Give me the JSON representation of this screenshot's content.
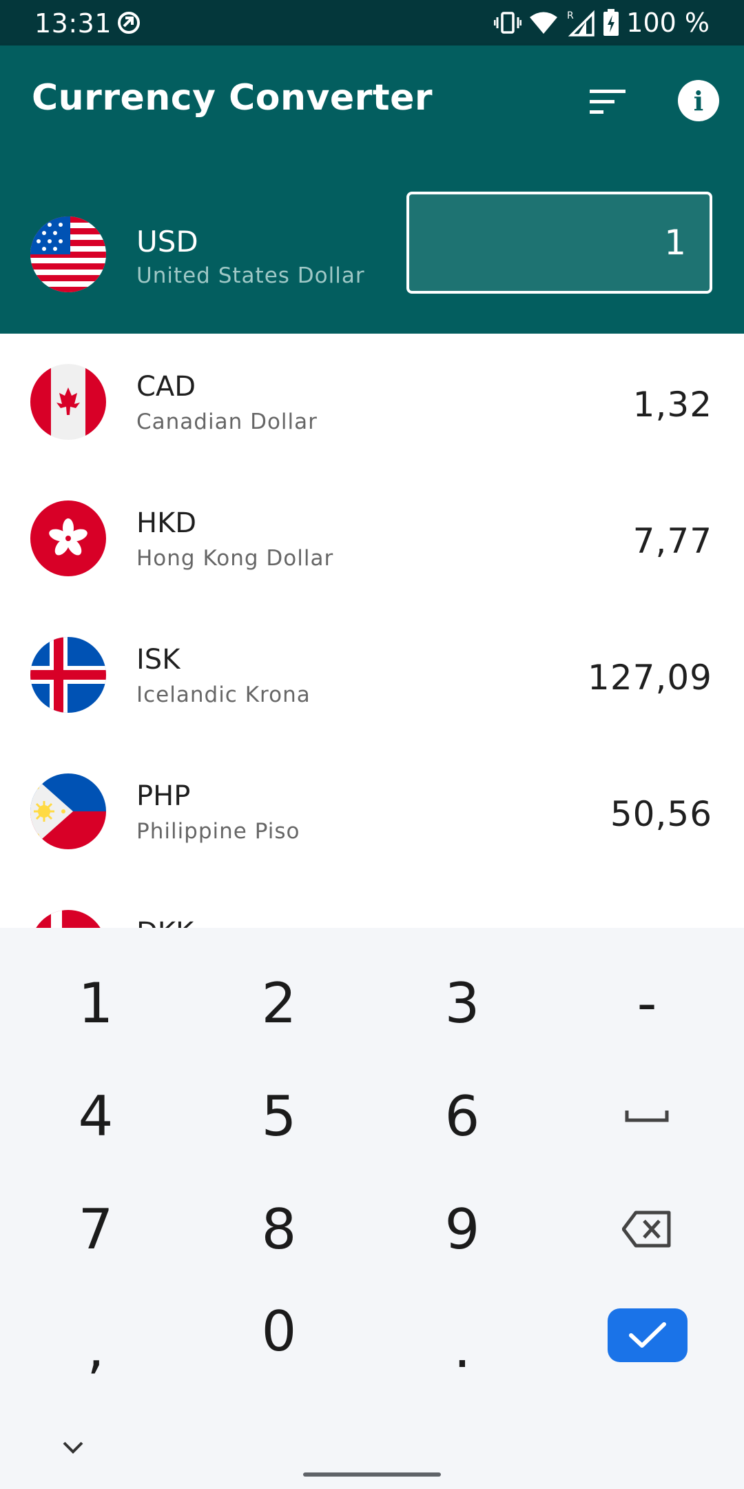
{
  "status_bar": {
    "time": "13:31",
    "battery": "100 %",
    "icons": [
      "sync-icon",
      "vibrate-icon",
      "wifi-icon",
      "signal-roaming-icon",
      "battery-charging-icon"
    ]
  },
  "app_bar": {
    "title": "Currency Converter",
    "background": "#035e5f",
    "actions": [
      "sort-icon",
      "info-icon"
    ]
  },
  "base_currency": {
    "code": "USD",
    "name": "United States Dollar",
    "amount": "1",
    "flag": "us-flag-icon"
  },
  "rates": [
    {
      "code": "CAD",
      "name": "Canadian Dollar",
      "value": "1,32",
      "flag": "ca-flag-icon"
    },
    {
      "code": "HKD",
      "name": "Hong Kong Dollar",
      "value": "7,77",
      "flag": "hk-flag-icon"
    },
    {
      "code": "ISK",
      "name": "Icelandic Krona",
      "value": "127,09",
      "flag": "is-flag-icon"
    },
    {
      "code": "PHP",
      "name": "Philippine Piso",
      "value": "50,56",
      "flag": "ph-flag-icon"
    },
    {
      "code": "DKK",
      "name": "",
      "value": "",
      "flag": "dk-flag-icon"
    }
  ],
  "keyboard": {
    "keys": [
      [
        "1",
        "2",
        "3",
        "-"
      ],
      [
        "4",
        "5",
        "6",
        "space-icon"
      ],
      [
        "7",
        "8",
        "9",
        "backspace-icon"
      ],
      [
        ",",
        "0",
        ".",
        "done-icon"
      ]
    ],
    "accent": "#1a73e8"
  }
}
